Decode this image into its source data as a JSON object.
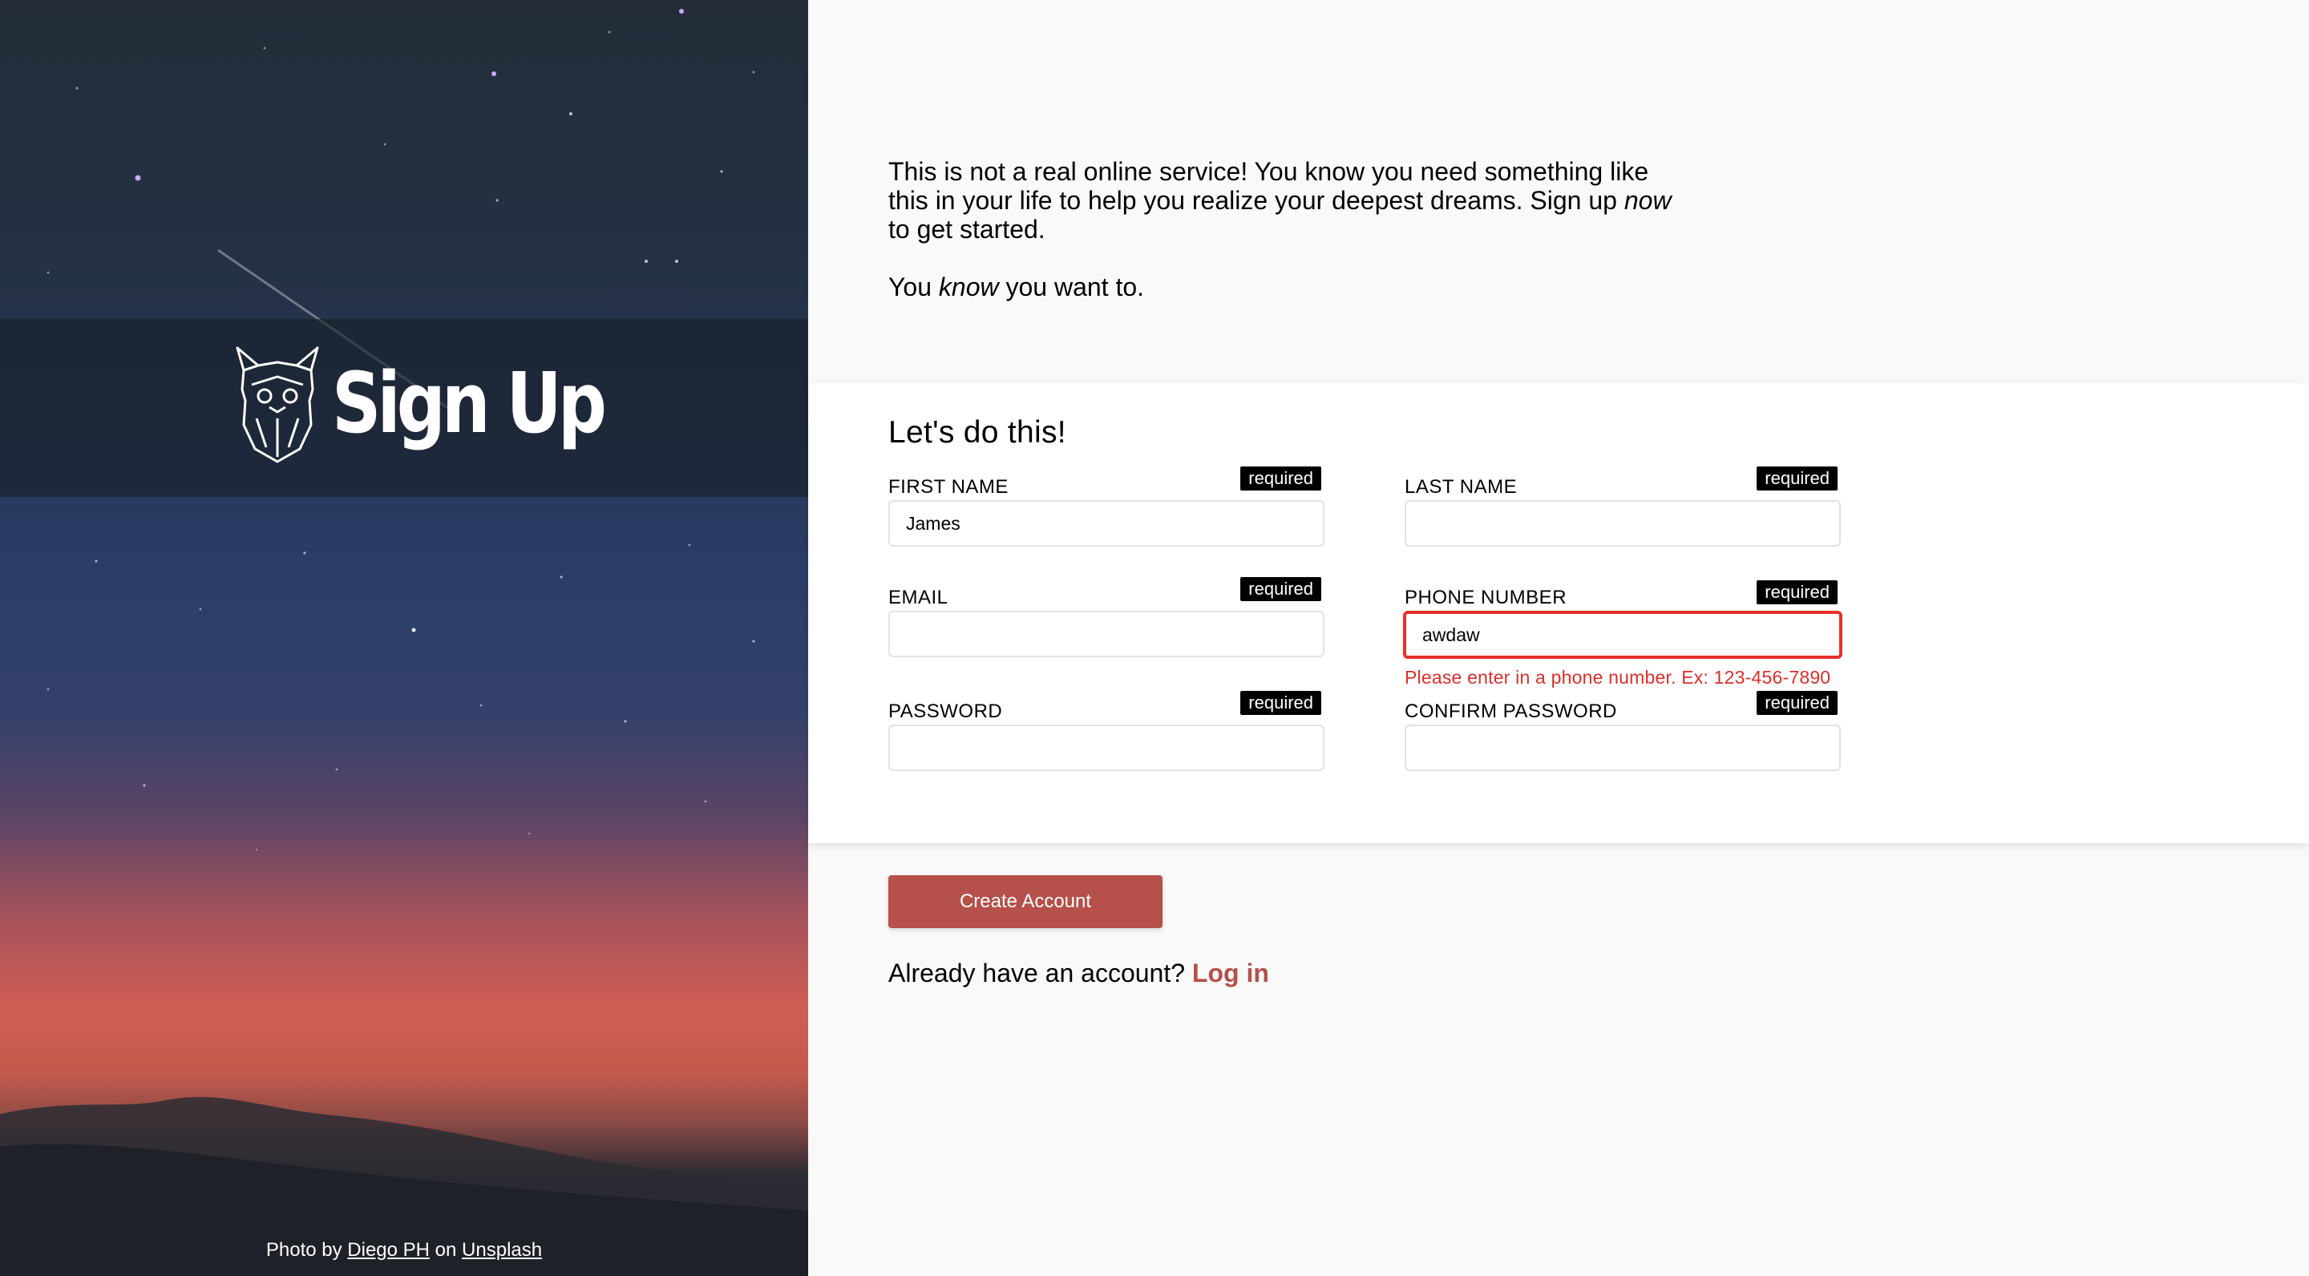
{
  "hero": {
    "title": "Sign Up",
    "credit": {
      "prefix": "Photo by",
      "author": "Diego PH",
      "middle": "on",
      "site": "Unsplash"
    }
  },
  "intro": {
    "p1_start": "This is not a real online service! You know you need something like this in your life to help you realize your deepest dreams. Sign up",
    "p1_em": "now",
    "p1_end": "to get started.",
    "p2_start": "You",
    "p2_em": "know",
    "p2_end": "you want to."
  },
  "form": {
    "heading": "Let's do this!",
    "required_badge": "required",
    "fields": {
      "first_name": {
        "label": "FIRST NAME",
        "value": "James"
      },
      "last_name": {
        "label": "LAST NAME",
        "value": ""
      },
      "email": {
        "label": "EMAIL",
        "value": ""
      },
      "phone": {
        "label": "PHONE NUMBER",
        "value": "awdaw",
        "error": "Please enter in a phone number. Ex: 123-456-7890"
      },
      "password": {
        "label": "PASSWORD",
        "value": ""
      },
      "confirm_password": {
        "label": "CONFIRM PASSWORD",
        "value": ""
      }
    }
  },
  "actions": {
    "create_account": "Create Account",
    "login_prompt": "Already have an account?",
    "login_link": "Log in"
  },
  "colors": {
    "accent": "#b6504a",
    "error": "#e5302a",
    "badge": "#000000"
  },
  "icons": {
    "logo": "viking-dog-logo-icon"
  }
}
